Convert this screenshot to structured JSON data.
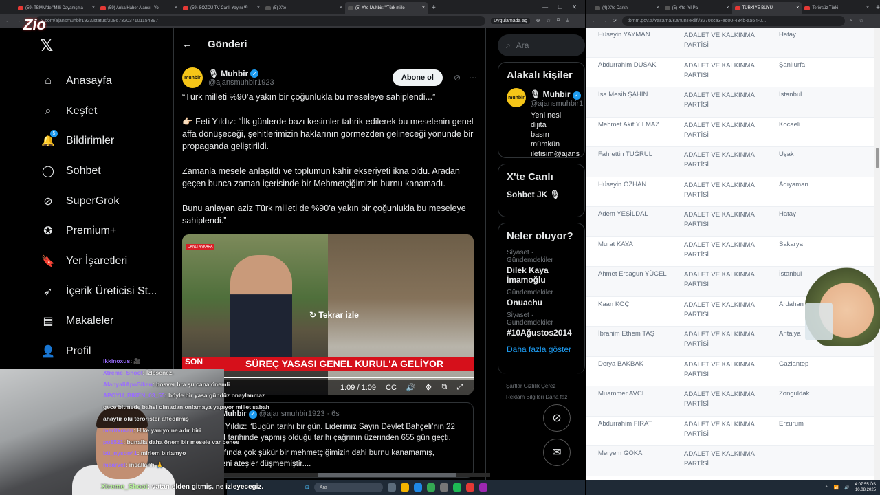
{
  "left": {
    "tabs": [
      {
        "label": "(59) TBMM'de \"Milli Dayanışma",
        "color": "#e53935"
      },
      {
        "label": "(59) Anka Haber Ajansı - Yo",
        "color": "#e53935"
      },
      {
        "label": "(59) SÖZCÜ TV Canlı Yayını ᴴᴰ",
        "color": "#e53935"
      },
      {
        "label": "(5) X'te",
        "color": "#555555"
      },
      {
        "label": "(5) X'te Muhbir: \"'Türk mille",
        "color": "#555555"
      }
    ],
    "url": "x.com/ajansmuhbir1923/status/2086732037101154397",
    "app_chip": "Uygulamada aç",
    "nav": [
      {
        "label": "Anasayfa",
        "icon": "home-icon"
      },
      {
        "label": "Keşfet",
        "icon": "search-icon"
      },
      {
        "label": "Bildirimler",
        "icon": "bell-icon",
        "badge": "5"
      },
      {
        "label": "Sohbet",
        "icon": "chat-icon"
      },
      {
        "label": "SuperGrok",
        "icon": "grok-icon"
      },
      {
        "label": "Premium+",
        "icon": "premium-icon"
      },
      {
        "label": "Yer İşaretleri",
        "icon": "bookmark-icon"
      },
      {
        "label": "İçerik Üreticisi St...",
        "icon": "rocket-icon"
      },
      {
        "label": "Makaleler",
        "icon": "article-icon"
      },
      {
        "label": "Profil",
        "icon": "profile-icon"
      }
    ],
    "post": {
      "header": "Gönderi",
      "avatar_text": "muhbir",
      "name": "Muhbir",
      "handle": "@ajansmuhbir1923",
      "follow": "Abone ol",
      "paragraphs": [
        "“Türk milleti %90’a yakın bir çoğunlukla bu meseleye sahiplendi...”",
        "👉🏻 Feti Yıldız: “İlk günlerde bazı kesimler tahrik edilerek bu meselenin genel affa dönüşeceği, şehitlerimizin haklarının görmezden gelineceği yönünde bir propaganda geliştirildi.",
        "Zamanla mesele anlaşıldı ve toplumun kahir ekseriyeti ikna oldu. Aradan geçen bunca zaman içerisinde bir Mehmetçiğimizin burnu kanamadı.",
        "Bunu anlayan aziz Türk milleti de %90’a yakın bir çoğunlukla bu meseleye sahiplendi.”"
      ],
      "video": {
        "live_tag": "CANLI ANKARA",
        "replay": "Tekrar izle",
        "banner_left": "SON",
        "banner": "SÜREÇ YASASI GENEL KURUL'A GELİYOR",
        "time": "1:09 / 1:09",
        "cc": "CC"
      },
      "reply": {
        "name": "Muhbir",
        "handle": "@ajansmuhbir1923 · 6s",
        "text1": "i Yıldız: “Bugün tarihi bir gün. Liderimiz Sayın Devlet Bahçeli’nin 22",
        "text2": "4 tarihinde yapmış olduğu tarihi çağrının üzerinden 655 gün geçti.",
        "text3": "rfında çok şükür bir mehmetçiğimizin dahi burnu kanamamış,",
        "text4": "eni ateşler düşmemiştir...."
      }
    },
    "sidebar": {
      "search_placeholder": "Ara",
      "related_title": "Alakalı kişiler",
      "rel_name": "Muhbir",
      "rel_handle": "@ajansmuhbir1",
      "rel_bio1": "Yeni nesil dijita",
      "rel_bio2": "basın mümkün",
      "rel_bio3": "iletisim@ajans",
      "live_title": "X'te Canlı",
      "live_item": "Sohbet JK 🎙",
      "trends_title": "Neler oluyor?",
      "trends": [
        {
          "meta": "Siyaset · Gündemdekiler",
          "name": "Dilek Kaya İmamoğlu"
        },
        {
          "meta": "Gündemdekiler",
          "name": "Onuachu"
        },
        {
          "meta": "Siyaset · Gündemdekiler",
          "name": "#10Ağustos2014"
        }
      ],
      "more": "Daha fazla göster",
      "footer1": "Şartlar   Gizlilik   Çerez",
      "footer2": "Reklam Bilgileri   Daha faz"
    },
    "taskbar_search": "Ara"
  },
  "right": {
    "tabs": [
      {
        "label": "(4) X'te Darkh",
        "color": "#555555"
      },
      {
        "label": "(5) X'te İYİ Pa",
        "color": "#555555"
      },
      {
        "label": "TÜRKİYE BÜYÜ",
        "color": "#e53935"
      },
      {
        "label": "Terörsüz Türki",
        "color": "#e53935"
      }
    ],
    "url": "tbmm.gov.tr/Yasama/KanunTeklifi/3270cca3-ed00-434b-aa64-0...",
    "rows": [
      {
        "name": "Hüseyin YAYMAN",
        "party": "ADALET VE KALKINMA PARTİSİ",
        "city": "Hatay"
      },
      {
        "name": "Abdurrahim DUSAK",
        "party": "ADALET VE KALKINMA PARTİSİ",
        "city": "Şanlıurfa"
      },
      {
        "name": "İsa Mesih ŞAHİN",
        "party": "ADALET VE KALKINMA PARTİSİ",
        "city": "İstanbul"
      },
      {
        "name": "Mehmet Akif YILMAZ",
        "party": "ADALET VE KALKINMA PARTİSİ",
        "city": "Kocaeli"
      },
      {
        "name": "Fahrettin TUĞRUL",
        "party": "ADALET VE KALKINMA PARTİSİ",
        "city": "Uşak"
      },
      {
        "name": "Hüseyin ÖZHAN",
        "party": "ADALET VE KALKINMA PARTİSİ",
        "city": "Adıyaman"
      },
      {
        "name": "Adem YEŞİLDAL",
        "party": "ADALET VE KALKINMA PARTİSİ",
        "city": "Hatay"
      },
      {
        "name": "Murat KAYA",
        "party": "ADALET VE KALKINMA PARTİSİ",
        "city": "Sakarya"
      },
      {
        "name": "Ahmet Ersagun YÜCEL",
        "party": "ADALET VE KALKINMA PARTİSİ",
        "city": "İstanbul"
      },
      {
        "name": "Kaan KOÇ",
        "party": "ADALET VE KALKINMA PARTİSİ",
        "city": "Ardahan"
      },
      {
        "name": "İbrahim Ethem TAŞ",
        "party": "ADALET VE KALKINMA PARTİSİ",
        "city": "Antalya"
      },
      {
        "name": "Derya BAKBAK",
        "party": "ADALET VE KALKINMA PARTİSİ",
        "city": "Gaziantep"
      },
      {
        "name": "Muammer AVCI",
        "party": "ADALET VE KALKINMA PARTİSİ",
        "city": "Zonguldak"
      },
      {
        "name": "Abdurrahim FIRAT",
        "party": "ADALET VE KALKINMA PARTİSİ",
        "city": "Erzurum"
      },
      {
        "name": "Meryem GÖKA",
        "party": "ADALET VE KALKINMA PARTİSİ",
        "city": ""
      }
    ],
    "chat": [
      {
        "user": "ikkinoxus",
        "text": ": 🎥"
      },
      {
        "user": "Xtreme_Shoot",
        "text": ": İzlesenez."
      },
      {
        "user": "AlanyaliApoSiken",
        "text": ": bosver bra şu cana önemli"
      },
      {
        "user": "APOYU_BIKEN_03_55",
        "text": ": böyle bir yasa gündüz onaylanmaz"
      },
      {
        "user": "",
        "text": "gece bitmede bahsi olmadan onlamaya yapıyor millet sabah"
      },
      {
        "user": "",
        "text": "ahaytır olu terörister affedilmiş"
      },
      {
        "user": "meritkoran",
        "text": ": Hike yanıyo ne adır biri"
      },
      {
        "user": "po1521",
        "text": ": bunalla daha önem bir mesele var benee"
      },
      {
        "user": "bü_nyson41",
        "text": ": mirlem bırlamyo"
      },
      {
        "user": "mearvet",
        "text": ": insallahh 🙏"
      }
    ],
    "chat_last_user": "Xtreme_Shoot",
    "chat_last_text": ": vatan elden gitmiş. ne izleyecegiz.",
    "clock": "4:07:55 ÖS",
    "date": "10.08.2025"
  }
}
